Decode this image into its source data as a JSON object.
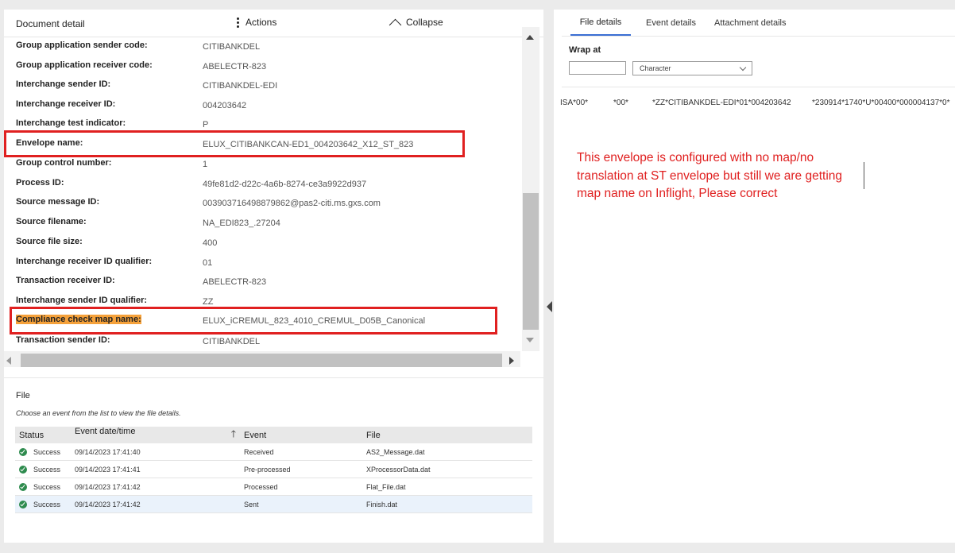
{
  "header": {
    "title": "Document detail",
    "actions_label": "Actions",
    "collapse_label": "Collapse"
  },
  "fields": [
    {
      "label": "Group application sender code:",
      "value": "CITIBANKDEL"
    },
    {
      "label": "Group application receiver code:",
      "value": "ABELECTR-823"
    },
    {
      "label": "Interchange sender ID:",
      "value": "CITIBANKDEL-EDI"
    },
    {
      "label": "Interchange receiver ID:",
      "value": "004203642"
    },
    {
      "label": "Interchange test indicator:",
      "value": "P"
    },
    {
      "label": "Envelope name:",
      "value": "ELUX_CITIBANKCAN-ED1_004203642_X12_ST_823"
    },
    {
      "label": "Group control number:",
      "value": "1"
    },
    {
      "label": "Process ID:",
      "value": "49fe81d2-d22c-4a6b-8274-ce3a9922d937"
    },
    {
      "label": "Source message ID:",
      "value": "003903716498879862@pas2-citi.ms.gxs.com"
    },
    {
      "label": "Source filename:",
      "value": "NA_EDI823_.27204"
    },
    {
      "label": "Source file size:",
      "value": "400"
    },
    {
      "label": "Interchange receiver ID qualifier:",
      "value": "01"
    },
    {
      "label": "Transaction receiver ID:",
      "value": "ABELECTR-823"
    },
    {
      "label": "Interchange sender ID qualifier:",
      "value": "ZZ"
    },
    {
      "label": "Compliance check map name:",
      "value": "ELUX_iCREMUL_823_4010_CREMUL_D05B_Canonical"
    },
    {
      "label": "Transaction sender ID:",
      "value": "CITIBANKDEL"
    }
  ],
  "file_section": {
    "title": "File",
    "hint": "Choose an event from the list to view the file details.",
    "columns": [
      "Status",
      "Event date/time",
      "Event",
      "File"
    ],
    "rows": [
      {
        "status": "Success",
        "datetime": "09/14/2023 17:41:40",
        "event": "Received",
        "file": "AS2_Message.dat"
      },
      {
        "status": "Success",
        "datetime": "09/14/2023 17:41:41",
        "event": "Pre-processed",
        "file": "XProcessorData.dat"
      },
      {
        "status": "Success",
        "datetime": "09/14/2023 17:41:42",
        "event": "Processed",
        "file": "Flat_File.dat"
      },
      {
        "status": "Success",
        "datetime": "09/14/2023 17:41:42",
        "event": "Sent",
        "file": "Finish.dat"
      }
    ]
  },
  "right_panel": {
    "tabs": [
      "File details",
      "Event details",
      "Attachment details"
    ],
    "wrap_label": "Wrap at",
    "wrap_value": "",
    "wrap_unit": "Character",
    "edi_segments": [
      "ISA*00*",
      "*00*",
      "*ZZ*CITIBANKDEL-EDI*01*004203642",
      "*230914*1740*U*00400*000004137*0*"
    ]
  },
  "annotation": "This envelope is configured with no map/no translation at ST envelope but still we are getting map name on Inflight, Please correct",
  "colors": {
    "highlight_box": "#e02020",
    "label_highlight": "#f5a13a",
    "success": "#2e8b4e",
    "tab_active": "#3b6fd4"
  }
}
